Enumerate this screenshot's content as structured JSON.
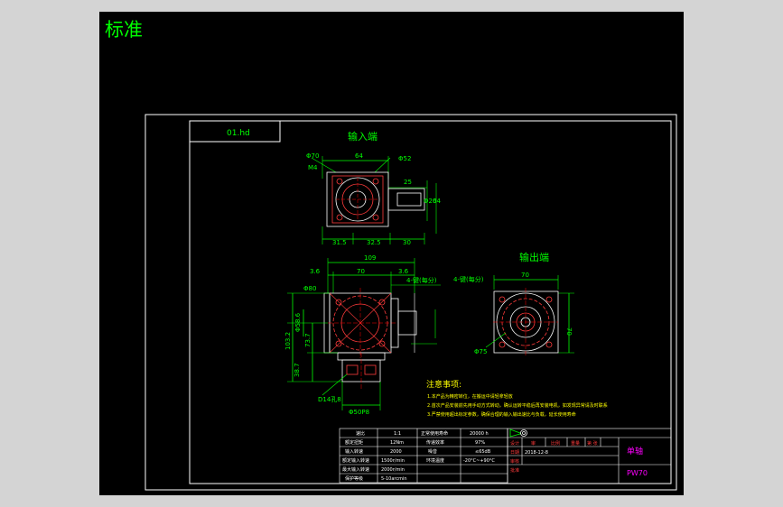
{
  "viewport": {
    "tab_title": "标准",
    "background": "#000000",
    "ui_color": "#00ff00"
  },
  "colors": {
    "frame": "#ffffff",
    "dimension": "#00ff00",
    "part": "#ff3b3b",
    "center": "#ff0000",
    "note": "#ffff00",
    "title": "#00ff00",
    "accent": "#ff00ff"
  },
  "drawing": {
    "label_box": "01.hd",
    "input_end_label": "输入端",
    "output_end_label": "输出端",
    "top_view": {
      "dia_left": "Φ70",
      "m_left": "M4",
      "width": "64",
      "dia_right": "Φ52",
      "shaft_len": "25",
      "shaft_dia": "Φ20",
      "height": "64",
      "bottom_left": "31.5",
      "bottom_mid": "32.5",
      "bottom_right": "30"
    },
    "front_view": {
      "overall": "109",
      "left_offset": "3.6",
      "body": "70",
      "right_offset": "3.6",
      "key": "4-键(每分)",
      "dia_bore": "Φ80",
      "flange_dia": "Φ58.6",
      "height": "103.2",
      "h_mid": "73.7",
      "h_low": "38.7",
      "hole": "D14孔8",
      "bottom_dia": "Φ50P8"
    },
    "output_view": {
      "key": "4-键(每分)",
      "width": "70",
      "height": "70",
      "dia": "Φ75"
    },
    "notes_title": "注意事项:",
    "notes": [
      "1.本产品为精密转位，在搬运中请轻拿轻放",
      "2.首次产品安装前先用手动方式转动，确认运转平稳后再安装电机，如发现异常请及时联系",
      "3.严禁使用超出标定参数，确保合理的输入输出速比与负载，延长使用寿命"
    ]
  },
  "specs": {
    "rows": [
      [
        "速比",
        "1:1",
        "正常使用寿命",
        "20000 h"
      ],
      [
        "额定扭矩",
        "12Nm",
        "传递效率",
        "97%"
      ],
      [
        "输入转速",
        "2000",
        "噪音",
        "≤65dB"
      ],
      [
        "额定输入转速",
        "1500r/min",
        "环境温度",
        "-20°C~+90°C"
      ],
      [
        "最大输入转速",
        "2000r/min",
        "",
        ""
      ],
      [
        "保护等级",
        "5-10arcmin",
        "",
        ""
      ]
    ]
  },
  "title_block": {
    "headers": [
      "设计",
      "审",
      "比例",
      "重量",
      "第 张"
    ],
    "date_label": "日期",
    "date_value": "2018-12-8",
    "approve_label": "审核",
    "check_label": "批准",
    "part_name": "单轴",
    "part_code": "PW70"
  }
}
